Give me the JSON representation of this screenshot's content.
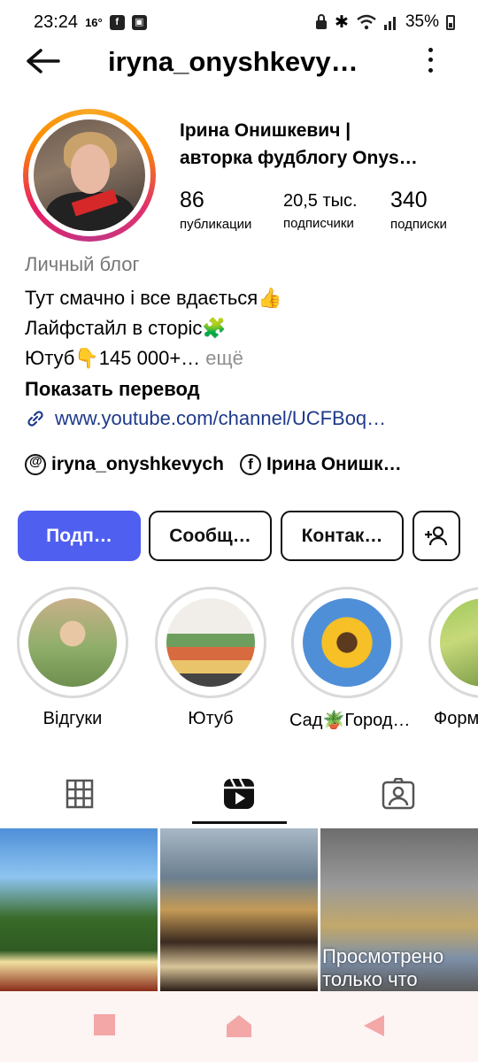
{
  "status_bar": {
    "time": "23:24",
    "temperature": "16°",
    "battery": "35%"
  },
  "header": {
    "username": "iryna_onyshkevy…"
  },
  "profile": {
    "name_line1": "Ірина Онишкевич |",
    "name_line2": "авторка фудблогу Onys…",
    "stats": [
      {
        "value": "86",
        "label": "публикации"
      },
      {
        "value": "20,5 тыс.",
        "label": "подписчики"
      },
      {
        "value": "340",
        "label": "подписки"
      }
    ],
    "category": "Личный блог",
    "bio_lines": [
      "Тут смачно і все вдається👍",
      "Лайфстайл в сторіс🧩",
      "Ютуб👇145 000+…"
    ],
    "bio_more": "ещё",
    "translate_label": "Показать перевод",
    "link": "www.youtube.com/channel/UCFBoq…",
    "threads_handle": "iryna_onyshkevych",
    "facebook_name": "Ірина Онишк…"
  },
  "buttons": {
    "follow": "Подп…",
    "message": "Сообщ…",
    "contact": "Контак…"
  },
  "highlights": [
    {
      "title": "Відгуки"
    },
    {
      "title": "Ютуб"
    },
    {
      "title": "Сад🪴Город…"
    },
    {
      "title": "Форм"
    }
  ],
  "grid": {
    "viewed_overlay": "Просмотрено только что"
  },
  "colors": {
    "primary_button": "#4f5ff0",
    "link": "#1e3a8a",
    "category_text": "#777777"
  }
}
